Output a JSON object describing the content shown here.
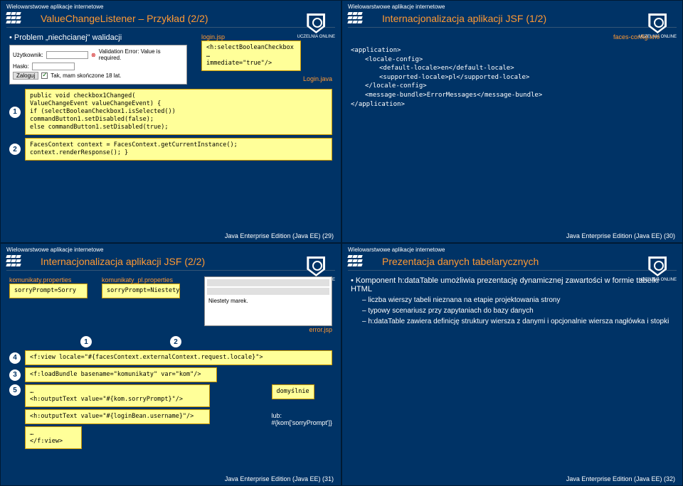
{
  "common": {
    "breadcrumb": "Wielowarstwowe aplikacje internetowe",
    "badge": "UCZELNIA ONLINE"
  },
  "slide29": {
    "title": "ValueChangeListener – Przykład (2/2)",
    "bullet": "Problem „niechcianej\" walidacji",
    "file1": "login.jsp",
    "snippet1a": "<h:selectBooleanCheckbox",
    "snippet1b": "…",
    "snippet1c": "immediate=\"true\"/>",
    "file2": "Login.java",
    "form": {
      "label_user": "Użytkownik:",
      "label_pass": "Hasło:",
      "err": "Validation Error: Value is required.",
      "login_btn": "Zaloguj",
      "checkbox_label": "Tak, mam skończone 18 lat."
    },
    "code1_l1": "public void checkbox1Changed(",
    "code1_l2": "            ValueChangeEvent valueChangeEvent) {",
    "code1_l3": "if (selectBooleanCheckbox1.isSelected())",
    "code1_l4": "        commandButton1.setDisabled(false);",
    "code1_l5": "else  commandButton1.setDisabled(true);",
    "code2_l1": "FacesContext context = FacesContext.getCurrentInstance();",
    "code2_l2": "context.renderResponse(); }",
    "footer": "Java Enterprise Edition (Java EE) (29)"
  },
  "slide30": {
    "title": "Internacjonalizacja aplikacji JSF (1/2)",
    "file": "faces-config.xml",
    "l1": "<application>",
    "l2": "<locale-config>",
    "l3": "<default-locale>en</default-locale>",
    "l4": "<supported-locale>pl</supported-locale>",
    "l5": "</locale-config>",
    "l6": "<message-bundle>ErrorMessages</message-bundle>",
    "l7": "</application>",
    "footer": "Java Enterprise Edition (Java EE) (30)"
  },
  "slide31": {
    "title": "Internacjonalizacja aplikacji JSF (2/2)",
    "file1": "komunikaty.properties",
    "box1": "sorryPrompt=Sorry",
    "file2": "komunikaty_pl.properties",
    "box2": "sorryPrompt=Niestety",
    "file3": "error.jsp",
    "browser_text": "Niestety marek.",
    "code_l1": "<f:view locale=\"#{facesContext.externalContext.request.locale}\">",
    "code_l2": "<f:loadBundle basename=\"komunikaty\" var=\"kom\"/>",
    "code_l3": "…",
    "code_l4": "<h:outputText value=\"#{kom.sorryPrompt}\"/>",
    "code_l5": "<h:outputText value=\"#{loginBean.username}\"/>",
    "code_l6": "…",
    "code_l7": "</f:view>",
    "note1": "domyślnie",
    "note2": "lub:",
    "note3": "#{kom['sorryPrompt']}",
    "footer": "Java Enterprise Edition (Java EE) (31)"
  },
  "slide32": {
    "title": "Prezentacja danych tabelarycznych",
    "b1": "Komponent h:dataTable umożliwia prezentację dynamicznej zawartości w formie tabelki HTML",
    "sb1": "liczba wierszy tabeli nieznana na etapie projektowania strony",
    "sb2": "typowy scenariusz przy zapytaniach do bazy danych",
    "sb3": "h:dataTable zawiera definicję struktury wiersza z danymi i opcjonalnie wiersza nagłówka i stopki",
    "footer": "Java Enterprise Edition (Java EE) (32)"
  }
}
